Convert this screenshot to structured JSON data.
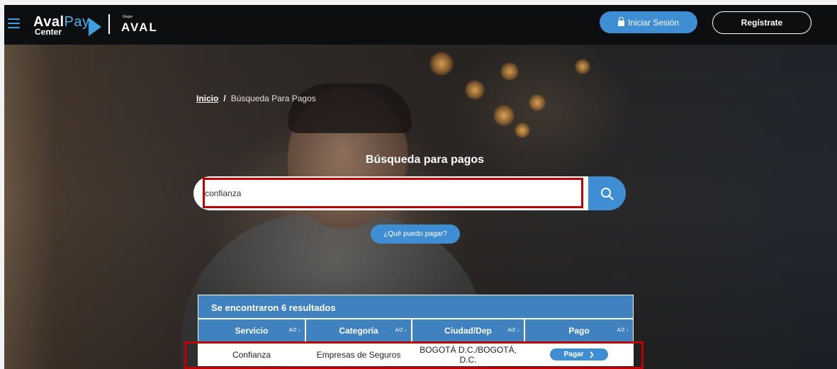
{
  "header": {
    "logo": {
      "brand": "Aval",
      "brand2": "Pay",
      "sub": "Center",
      "group_small": "Grupo",
      "group": "AVAL"
    },
    "login_label": "Iniciar Sesión",
    "register_label": "Regístrate"
  },
  "breadcrumb": {
    "home": "Inicio",
    "separator": "/",
    "current": "Búsqueda Para Pagos"
  },
  "search": {
    "title": "Búsqueda para pagos",
    "value": "confianza",
    "what_label": "¿Qué puedo pagar?"
  },
  "results": {
    "summary": "Se encontraron 6 resultados",
    "columns": [
      {
        "label": "Servicio",
        "sort": "A/Z ↓"
      },
      {
        "label": "Categoría",
        "sort": "A/Z ↓"
      },
      {
        "label": "Ciudad/Dep",
        "sort": "A/Z ↓"
      },
      {
        "label": "Pago",
        "sort": "A/Z ↓"
      }
    ],
    "rows": [
      {
        "servicio": "Confianza",
        "categoria": "Empresas de Seguros",
        "ciudad": "BOGOTÁ D.C./BOGOTÁ, D.C.",
        "pago": "Pagar"
      }
    ]
  },
  "colors": {
    "accent": "#3f8ed4",
    "table_header": "#3f82bf",
    "highlight": "#c00000",
    "topbar": "#0d0e10"
  },
  "icons": {
    "menu": "hamburger-icon",
    "lock": "lock-icon",
    "search": "search-icon",
    "arrow": "chevron-right-icon"
  }
}
